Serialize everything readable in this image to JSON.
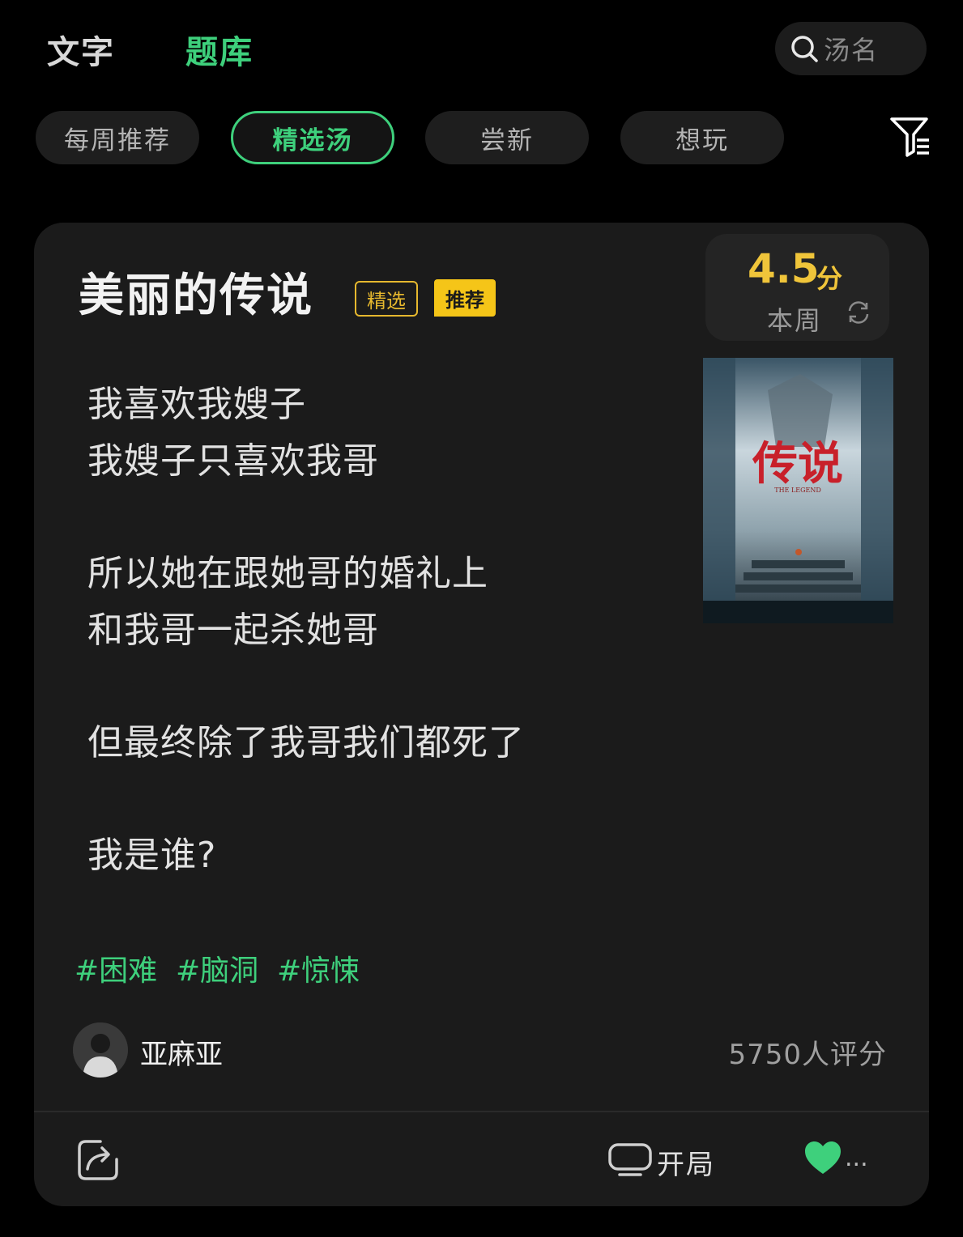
{
  "top_tabs": [
    {
      "label": "文字",
      "active": false
    },
    {
      "label": "题库",
      "active": true
    }
  ],
  "search": {
    "placeholder": "汤名",
    "icon": "search-icon"
  },
  "chips": [
    {
      "label": "每周推荐",
      "active": false
    },
    {
      "label": "精选汤",
      "active": true
    },
    {
      "label": "尝新",
      "active": false
    },
    {
      "label": "想玩",
      "active": false
    }
  ],
  "filter_icon": "filter-icon",
  "card": {
    "title": "美丽的传说",
    "badges": [
      "精选",
      "推荐"
    ],
    "score": {
      "value": "4.5",
      "unit": "分",
      "period": "本周"
    },
    "poster": {
      "title": "传说",
      "subtitle": "THE LEGEND"
    },
    "story_lines": [
      "我喜欢我嫂子",
      "我嫂子只喜欢我哥",
      "所以她在跟她哥的婚礼上",
      "和我哥一起杀她哥",
      "但最终除了我哥我们都死了",
      "我是谁?"
    ],
    "tags": [
      "#困难",
      "#脑洞",
      "#惊悚"
    ],
    "author": "亚麻亚",
    "rating_count": "5750人评分",
    "actions": {
      "open_label": "开局",
      "more": "..."
    }
  },
  "colors": {
    "accent": "#3ed07c",
    "gold": "#f0c53a",
    "background": "#000000",
    "card": "#1b1b1b"
  }
}
